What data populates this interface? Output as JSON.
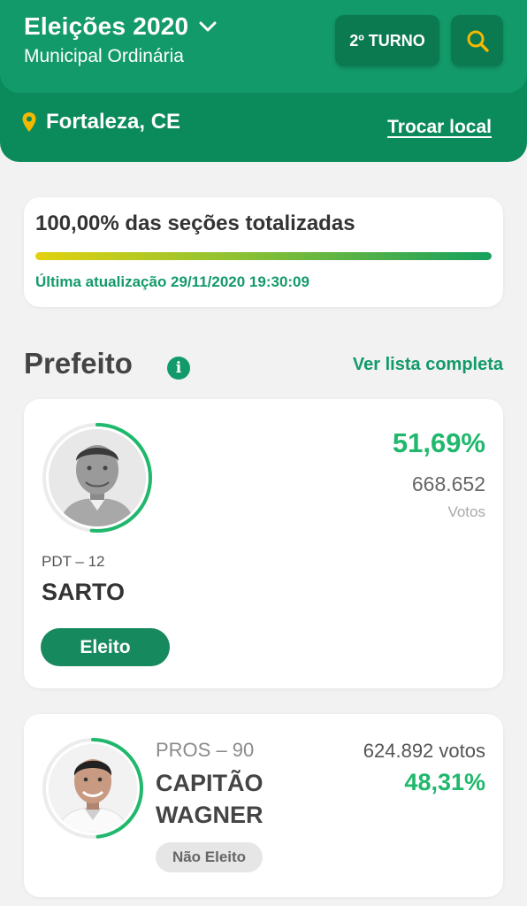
{
  "header": {
    "title": "Eleições 2020",
    "subtitle": "Municipal Ordinária",
    "turno_label": "2º TURNO",
    "location": "Fortaleza, CE",
    "change_location_label": "Trocar local",
    "search_icon": "search-icon",
    "location_icon": "location-pin-icon",
    "dropdown_icon": "chevron-down-icon"
  },
  "status": {
    "sections_text": "100,00% das seções totalizadas",
    "progress": 1.0,
    "update_text": "Última atualização 29/11/2020 19:30:09"
  },
  "section": {
    "title": "Prefeito",
    "info_icon": "info-icon",
    "see_all_label": "Ver lista completa"
  },
  "candidates": [
    {
      "party": "PDT – 12",
      "name": "SARTO",
      "percent": "51,69%",
      "percent_value": 51.69,
      "votes": "668.652",
      "votes_label": "Votos",
      "status": "Eleito"
    },
    {
      "party": "PROS – 90",
      "name": "CAPITÃO WAGNER",
      "percent": "48,31%",
      "percent_value": 48.31,
      "votes": "624.892 votos",
      "status": "Não Eleito"
    }
  ],
  "colors": {
    "brand_green": "#139a6a",
    "dark_green": "#0b8a5b",
    "accent_yellow": "#f5b800",
    "percent_green": "#1fb86c"
  }
}
